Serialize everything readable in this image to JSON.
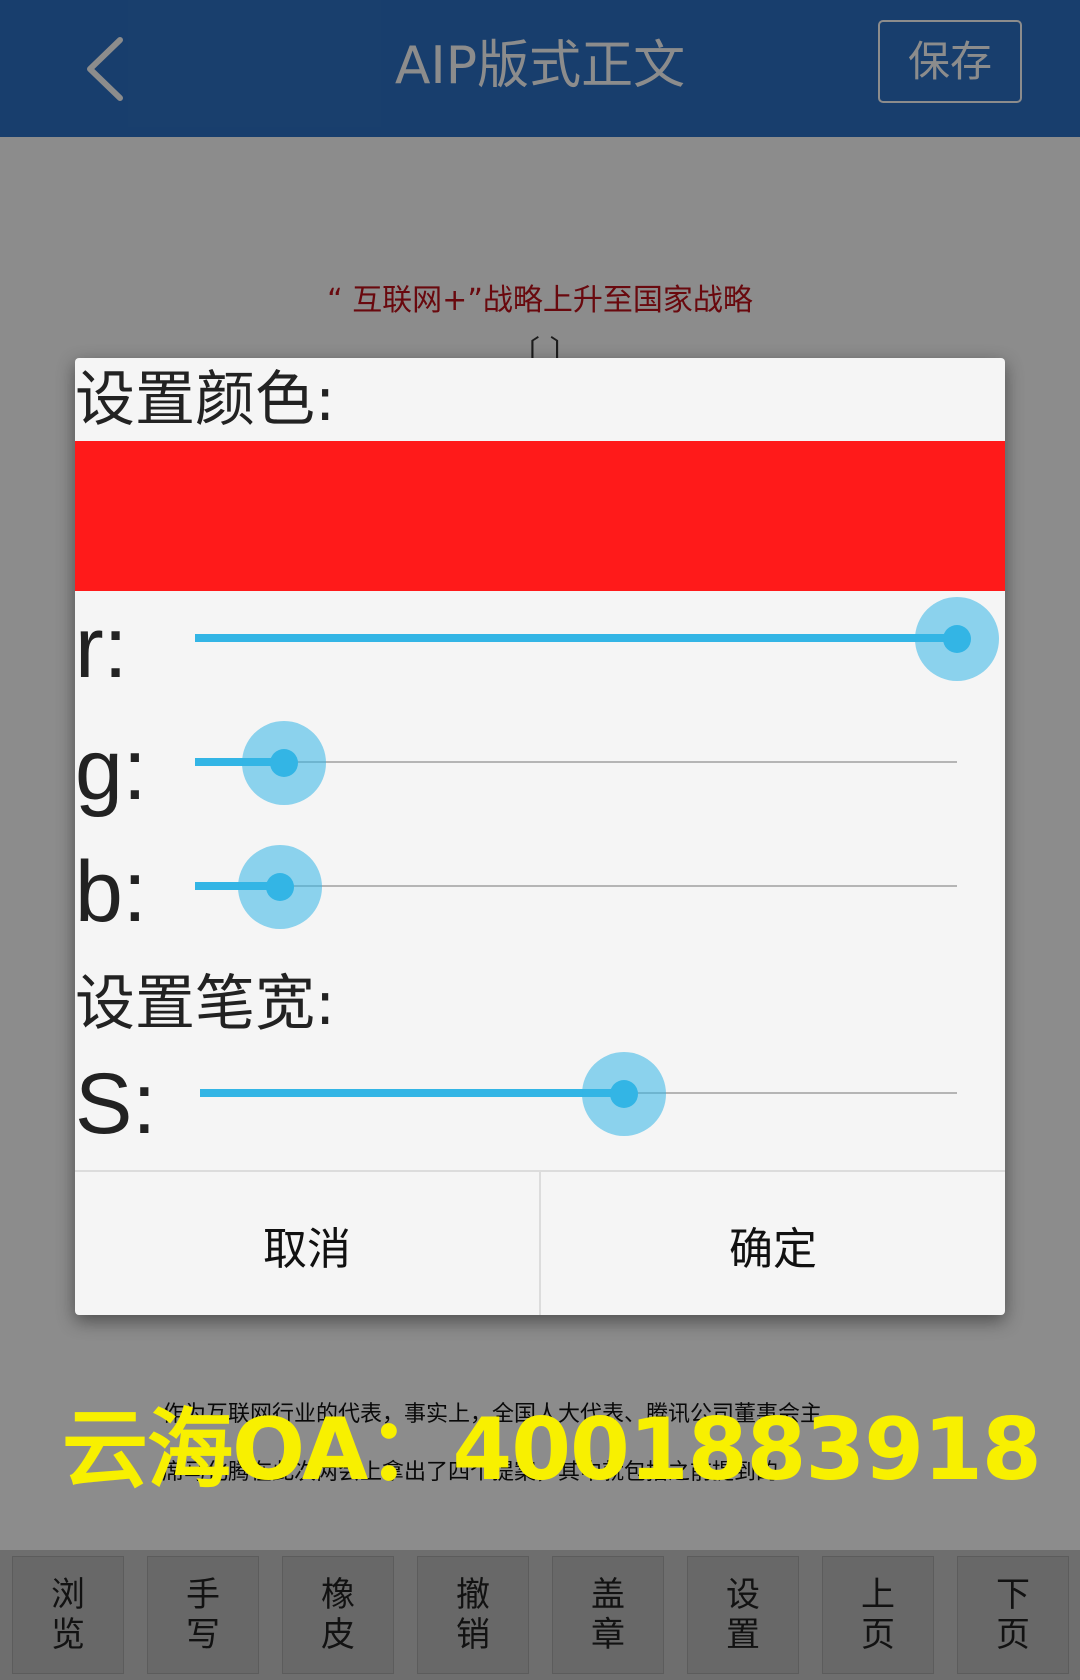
{
  "header": {
    "title": "AIP版式正文",
    "save_label": "保存",
    "back_icon": "chevron-left-icon",
    "background": "#2d72c7"
  },
  "document": {
    "heading": "“ 互联网+”战略上升至国家战略",
    "bracket": "〔 〕",
    "paragraph_line1": "作为互联网行业的代表，事实上，全国人大代表、腾讯公司董事会主",
    "paragraph_line2": "席马化腾在此次两会上拿出了四个提案，其中就包括之前提到的"
  },
  "dialog": {
    "color_label": "设置颜色:",
    "color_preview": "#ff1a1a",
    "channels": [
      {
        "label": "r:",
        "value": 255,
        "max": 255
      },
      {
        "label": "g:",
        "value": 26,
        "max": 255
      },
      {
        "label": "b:",
        "value": 24,
        "max": 255
      }
    ],
    "width_label": "设置笔宽:",
    "width_channel": {
      "label": "S:",
      "value": 0.56
    },
    "cancel_label": "取消",
    "confirm_label": "确定",
    "accent": "#33b5e5"
  },
  "toolbar": {
    "buttons": [
      {
        "top": "浏",
        "bottom": "览"
      },
      {
        "top": "手",
        "bottom": "写"
      },
      {
        "top": "橡",
        "bottom": "皮"
      },
      {
        "top": "撤",
        "bottom": "销"
      },
      {
        "top": "盖",
        "bottom": "章"
      },
      {
        "top": "设",
        "bottom": "置"
      },
      {
        "top": "上",
        "bottom": "页"
      },
      {
        "top": "下",
        "bottom": "页"
      }
    ]
  },
  "watermark": {
    "text": "云海OA：4001883918",
    "color": "#f8f000"
  }
}
